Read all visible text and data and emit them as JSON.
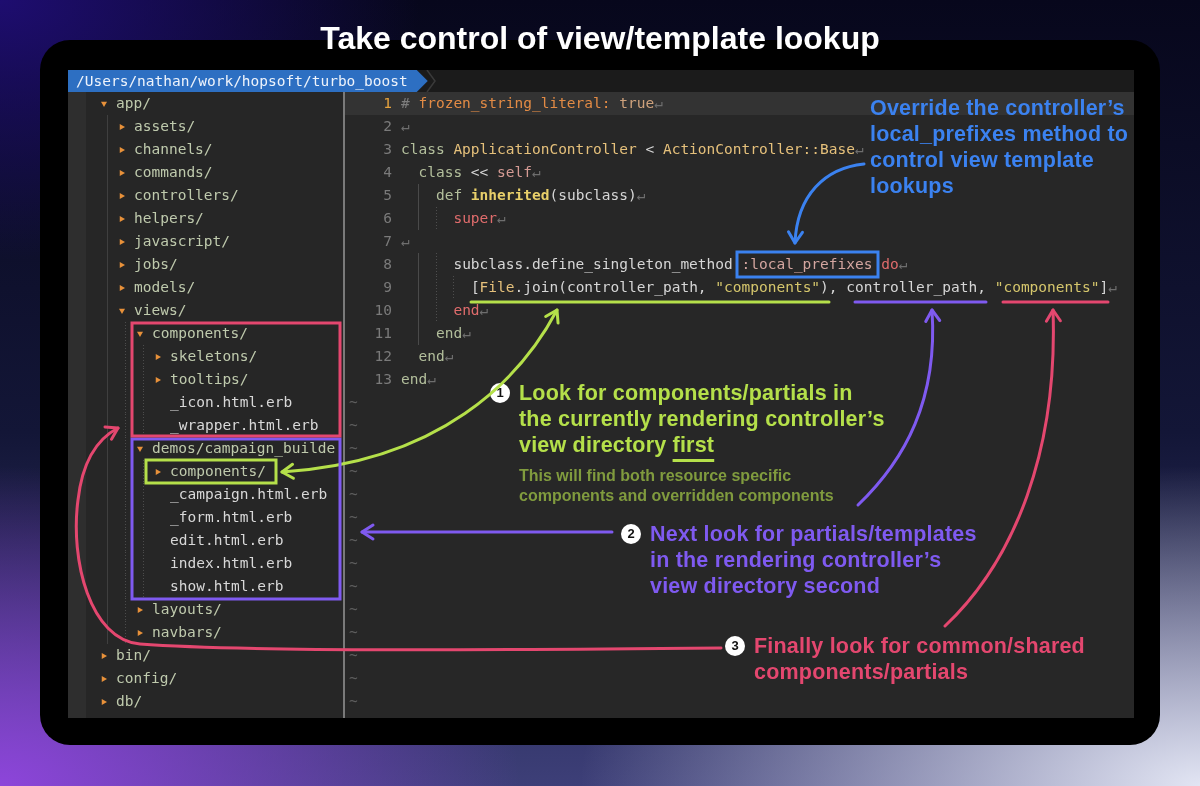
{
  "title": "Take control of view/template lookup",
  "path_bar": {
    "path": "/Users/nathan/work/hopsoft/turbo_boost"
  },
  "file_tree": [
    {
      "name": "app/",
      "kind": "folder",
      "expanded": true,
      "children": [
        {
          "name": "assets/",
          "kind": "folder",
          "expanded": false
        },
        {
          "name": "channels/",
          "kind": "folder",
          "expanded": false
        },
        {
          "name": "commands/",
          "kind": "folder",
          "expanded": false
        },
        {
          "name": "controllers/",
          "kind": "folder",
          "expanded": false
        },
        {
          "name": "helpers/",
          "kind": "folder",
          "expanded": false
        },
        {
          "name": "javascript/",
          "kind": "folder",
          "expanded": false
        },
        {
          "name": "jobs/",
          "kind": "folder",
          "expanded": false
        },
        {
          "name": "models/",
          "kind": "folder",
          "expanded": false
        },
        {
          "name": "views/",
          "kind": "folder",
          "expanded": true,
          "children": [
            {
              "name": "components/",
              "kind": "folder",
              "expanded": true,
              "children": [
                {
                  "name": "skeletons/",
                  "kind": "folder",
                  "expanded": false
                },
                {
                  "name": "tooltips/",
                  "kind": "folder",
                  "expanded": false
                },
                {
                  "name": "_icon.html.erb",
                  "kind": "file"
                },
                {
                  "name": "_wrapper.html.erb",
                  "kind": "file"
                }
              ]
            },
            {
              "name": "demos/campaign_builde",
              "kind": "folder",
              "expanded": true,
              "children": [
                {
                  "name": "components/",
                  "kind": "folder",
                  "expanded": false
                },
                {
                  "name": "_campaign.html.erb",
                  "kind": "file"
                },
                {
                  "name": "_form.html.erb",
                  "kind": "file"
                },
                {
                  "name": "edit.html.erb",
                  "kind": "file"
                },
                {
                  "name": "index.html.erb",
                  "kind": "file"
                },
                {
                  "name": "show.html.erb",
                  "kind": "file"
                }
              ]
            },
            {
              "name": "layouts/",
              "kind": "folder",
              "expanded": false
            },
            {
              "name": "navbars/",
              "kind": "folder",
              "expanded": false
            }
          ]
        }
      ]
    },
    {
      "name": "bin/",
      "kind": "folder",
      "expanded": false
    },
    {
      "name": "config/",
      "kind": "folder",
      "expanded": false
    },
    {
      "name": "db/",
      "kind": "folder",
      "expanded": false
    }
  ],
  "editor": {
    "lines": [
      {
        "number": "1",
        "current": true,
        "tokens": [
          {
            "text": "# ",
            "kind": "comment"
          },
          {
            "text": "frozen_string_literal:",
            "kind": "pragma"
          },
          {
            "text": " true",
            "kind": "flag"
          },
          {
            "text": "↵",
            "kind": "newline"
          }
        ]
      },
      {
        "number": "2",
        "current": false,
        "tokens": [
          {
            "text": "↵",
            "kind": "newline"
          }
        ]
      },
      {
        "number": "3",
        "current": false,
        "tokens": [
          {
            "text": "class",
            "kind": "keyword"
          },
          {
            "text": " ApplicationController",
            "kind": "constant"
          },
          {
            "text": " < ",
            "kind": "plain"
          },
          {
            "text": "ActionController::Base",
            "kind": "constant"
          },
          {
            "text": "↵",
            "kind": "newline"
          }
        ]
      },
      {
        "number": "4",
        "current": false,
        "tokens": [
          {
            "text": "  class",
            "kind": "keyword"
          },
          {
            "text": " << ",
            "kind": "plain"
          },
          {
            "text": "self",
            "kind": "self"
          },
          {
            "text": "↵",
            "kind": "newline"
          }
        ]
      },
      {
        "number": "5",
        "current": false,
        "tokens": [
          {
            "text": "    def ",
            "kind": "keyword"
          },
          {
            "text": "inherited",
            "kind": "method"
          },
          {
            "text": "(subclass)",
            "kind": "plain"
          },
          {
            "text": "↵",
            "kind": "newline"
          }
        ]
      },
      {
        "number": "6",
        "current": false,
        "tokens": [
          {
            "text": "      super",
            "kind": "control"
          },
          {
            "text": "↵",
            "kind": "newline"
          }
        ]
      },
      {
        "number": "7",
        "current": false,
        "tokens": [
          {
            "text": "↵",
            "kind": "newline"
          }
        ]
      },
      {
        "number": "8",
        "current": false,
        "tokens": [
          {
            "text": "      subclass.define_singleton_method ",
            "kind": "plain"
          },
          {
            "text": ":local_prefixes",
            "kind": "symbol"
          },
          {
            "text": " do",
            "kind": "control"
          },
          {
            "text": "↵",
            "kind": "newline"
          }
        ]
      },
      {
        "number": "9",
        "current": false,
        "tokens": [
          {
            "text": "        [",
            "kind": "plain"
          },
          {
            "text": "File",
            "kind": "constant"
          },
          {
            "text": ".join(controller_path, ",
            "kind": "plain"
          },
          {
            "text": "\"components\"",
            "kind": "string"
          },
          {
            "text": "), controller_path, ",
            "kind": "plain"
          },
          {
            "text": "\"components\"",
            "kind": "string"
          },
          {
            "text": "]",
            "kind": "plain"
          },
          {
            "text": "↵",
            "kind": "newline"
          }
        ]
      },
      {
        "number": "10",
        "current": false,
        "tokens": [
          {
            "text": "      end",
            "kind": "control"
          },
          {
            "text": "↵",
            "kind": "newline"
          }
        ]
      },
      {
        "number": "11",
        "current": false,
        "tokens": [
          {
            "text": "    end",
            "kind": "keyword"
          },
          {
            "text": "↵",
            "kind": "newline"
          }
        ]
      },
      {
        "number": "12",
        "current": false,
        "tokens": [
          {
            "text": "  end",
            "kind": "keyword"
          },
          {
            "text": "↵",
            "kind": "newline"
          }
        ]
      },
      {
        "number": "13",
        "current": false,
        "tokens": [
          {
            "text": "end",
            "kind": "keyword"
          },
          {
            "text": "↵",
            "kind": "newline"
          }
        ]
      }
    ],
    "filler_lines": [
      "~",
      "~",
      "~",
      "~",
      "~",
      "~",
      "~",
      "~",
      "~",
      "~",
      "~",
      "~",
      "~",
      "~"
    ]
  },
  "annotations": [
    {
      "kind": "callout",
      "color": "#3b82f0",
      "text": "Override the controller’s\nlocal_prefixes method to\ncontrol view template\nlookups"
    },
    {
      "kind": "step",
      "number": "1",
      "color": "#b5e04a",
      "text": "Look for components/partials in\nthe currently rendering controller’s\nview directory",
      "underlined": "first",
      "note": "This will find both resource specific\ncomponents and overridden components"
    },
    {
      "kind": "step",
      "number": "2",
      "color": "#7f5af0",
      "text": "Next look for partials/templates\nin the rendering controller’s\nview directory second"
    },
    {
      "kind": "step",
      "number": "3",
      "color": "#e4476f",
      "text": "Finally look for common/shared\ncomponents/partials"
    }
  ]
}
